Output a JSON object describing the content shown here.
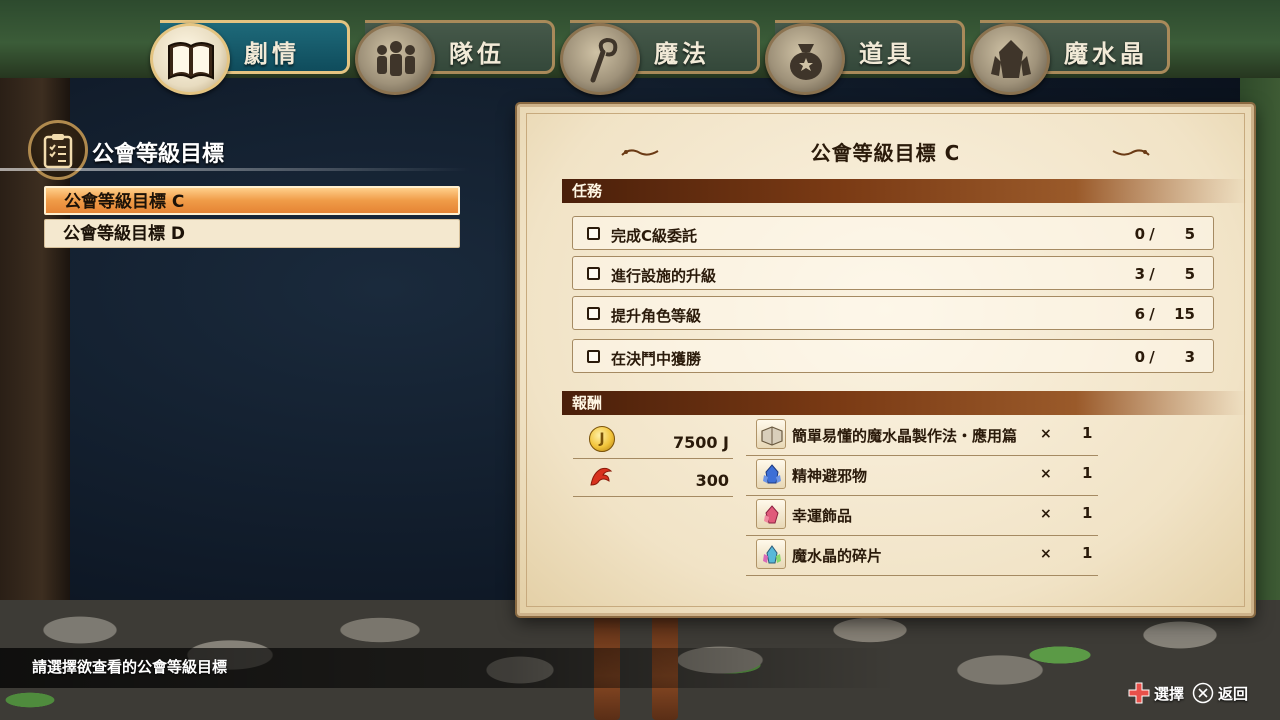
{
  "tabs": [
    {
      "label": "劇情",
      "icon": "book-icon",
      "active": true
    },
    {
      "label": "隊伍",
      "icon": "party-icon",
      "active": false
    },
    {
      "label": "魔法",
      "icon": "magic-staff-icon",
      "active": false
    },
    {
      "label": "道具",
      "icon": "item-bag-icon",
      "active": false
    },
    {
      "label": "魔水晶",
      "icon": "lacrima-crystal-icon",
      "active": false
    }
  ],
  "left_panel": {
    "title": "公會等級目標",
    "items": [
      {
        "label": "公會等級目標 C",
        "selected": true
      },
      {
        "label": "公會等級目標 D",
        "selected": false
      }
    ]
  },
  "detail": {
    "title": "公會等級目標 C",
    "tasks_header": "任務",
    "tasks": [
      {
        "label": "完成C級委託",
        "current": "0",
        "sep": "/",
        "max": "5"
      },
      {
        "label": "進行設施的升級",
        "current": "3",
        "sep": "/",
        "max": "5"
      },
      {
        "label": "提升角色等級",
        "current": "6",
        "sep": "/",
        "max": "15"
      },
      {
        "label": "在決鬥中獲勝",
        "current": "0",
        "sep": "/",
        "max": "3"
      }
    ],
    "rewards_header": "報酬",
    "currency_rewards": [
      {
        "icon": "jewel-coin-icon",
        "icon_text": "J",
        "amount": "7500 J"
      },
      {
        "icon": "fairy-tail-emblem-icon",
        "amount": "300"
      }
    ],
    "item_rewards": [
      {
        "icon": "book-icon",
        "name": "簡單易懂的魔水晶製作法・應用篇",
        "times": "×",
        "qty": "1"
      },
      {
        "icon": "blue-crystal-icon",
        "name": "精神避邪物",
        "times": "×",
        "qty": "1"
      },
      {
        "icon": "pink-crystal-icon",
        "name": "幸運飾品",
        "times": "×",
        "qty": "1"
      },
      {
        "icon": "rainbow-crystal-icon",
        "name": "魔水晶的碎片",
        "times": "×",
        "qty": "1"
      }
    ]
  },
  "footer": {
    "hint": "請選擇欲查看的公會等級目標",
    "select_label": "選擇",
    "back_label": "返回"
  },
  "colors": {
    "accent_orange": "#f09c48",
    "tab_active": "#0f4c5c",
    "section_bar": "#7a3a14",
    "parchment": "#f1e3c6"
  }
}
